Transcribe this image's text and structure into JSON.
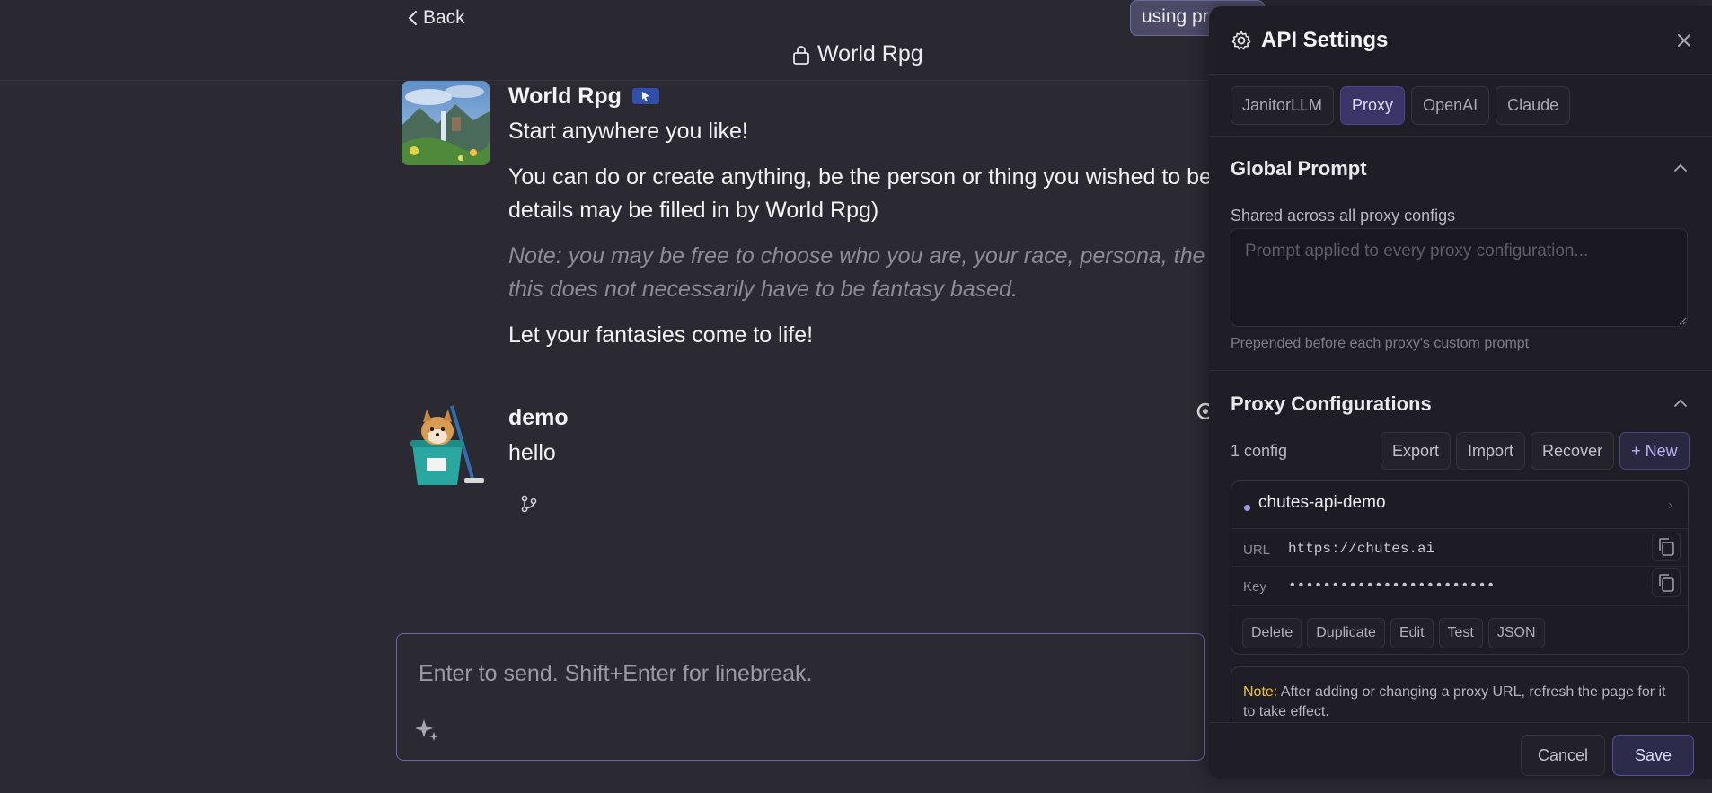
{
  "header": {
    "back_label": "Back",
    "chat_title": "World Rpg",
    "using_pill": "using pr"
  },
  "messages": [
    {
      "sender": "World Rpg",
      "paragraphs": [
        "Start anywhere you like!",
        "You can do or create anything, be the person or thing you wished to be.",
        "details may be filled in by World Rpg)",
        "Note: you may be free to choose who you are, your race, persona, the time",
        "this does not necessarily have to be fantasy based.",
        "Let your fantasies come to life!"
      ]
    },
    {
      "sender": "demo",
      "text": "hello"
    }
  ],
  "composer": {
    "placeholder": "Enter to send. Shift+Enter for linebreak."
  },
  "api_settings": {
    "title": "API Settings",
    "tabs": [
      {
        "label": "JanitorLLM",
        "active": false
      },
      {
        "label": "Proxy",
        "active": true
      },
      {
        "label": "OpenAI",
        "active": false
      },
      {
        "label": "Claude",
        "active": false
      }
    ],
    "global_prompt": {
      "title": "Global Prompt",
      "subtitle": "Shared across all proxy configs",
      "placeholder": "Prompt applied to every proxy configuration...",
      "hint": "Prepended before each proxy's custom prompt"
    },
    "proxy_configs": {
      "title": "Proxy Configurations",
      "count": "1 config",
      "actions": {
        "export": "Export",
        "import": "Import",
        "recover": "Recover",
        "new": "+ New"
      },
      "card": {
        "name": "chutes-api-demo",
        "url_label": "URL",
        "url_value": "https://chutes.ai",
        "key_label": "Key",
        "key_value": "••••••••••••••••••••••••",
        "actions": [
          "Delete",
          "Duplicate",
          "Edit",
          "Test",
          "JSON"
        ]
      },
      "note_label": "Note:",
      "note_text": " After adding or changing a proxy URL, refresh the page for it to take effect."
    },
    "footer": {
      "cancel": "Cancel",
      "save": "Save"
    }
  }
}
